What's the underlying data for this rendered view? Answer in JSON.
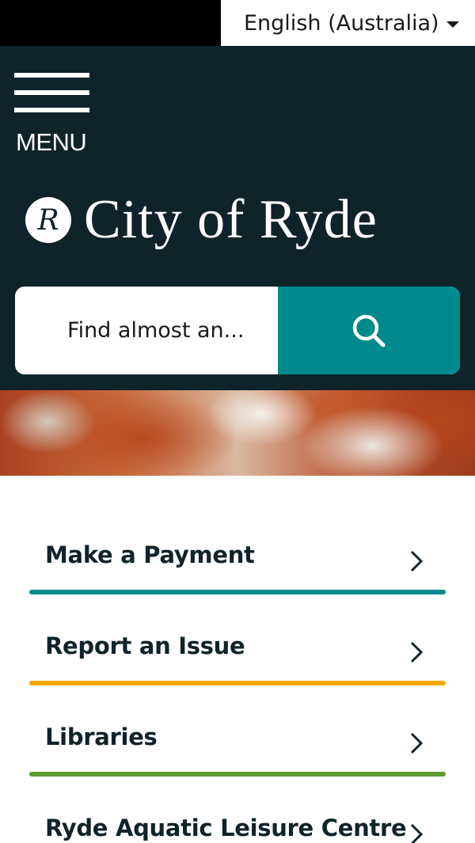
{
  "language": {
    "selected": "English (Australia)"
  },
  "header": {
    "menu_label": "MENU",
    "logo_mark": "R",
    "logo_text": "City of Ryde"
  },
  "search": {
    "placeholder": "Find almost an..."
  },
  "quick_links": [
    {
      "label": "Make a Payment",
      "accent": "#008a8e"
    },
    {
      "label": "Report an Issue",
      "accent": "#f2a800"
    },
    {
      "label": "Libraries",
      "accent": "#5a9a2a"
    },
    {
      "label": "Ryde Aquatic Leisure Centre",
      "accent": "#ffffff"
    }
  ],
  "colors": {
    "header_bg": "#0f232b",
    "search_button": "#008a8e"
  }
}
